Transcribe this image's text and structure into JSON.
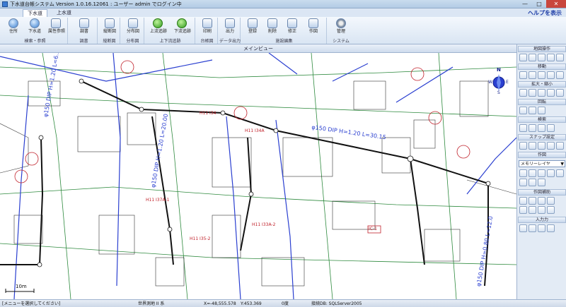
{
  "window": {
    "title": "下水道台帳システム  Version 1.0.16.12061 : ユーザー admin でログイン中",
    "minimize": "—",
    "maximize": "□",
    "close": "✕"
  },
  "tabs": [
    {
      "label": "下水道",
      "active": true
    },
    {
      "label": "上水道",
      "active": false
    }
  ],
  "help_link": "ヘルプを表示",
  "ribbon": {
    "groups": [
      {
        "label": "検索・参照",
        "buttons": [
          "住所",
          "下水道",
          "属性参照"
        ]
      },
      {
        "label": "調書",
        "buttons": [
          "調書"
        ]
      },
      {
        "label": "縦断図",
        "buttons": [
          "縦断図"
        ]
      },
      {
        "label": "分布図",
        "buttons": [
          "分布図"
        ]
      },
      {
        "label": "上下流追跡",
        "buttons": [
          "上流追跡",
          "下流追跡"
        ]
      },
      {
        "label": "台帳図",
        "buttons": [
          "印刷"
        ]
      },
      {
        "label": "データ出力",
        "buttons": [
          "出力"
        ]
      },
      {
        "label": "施設編集",
        "buttons": [
          "登録",
          "削除",
          "修正",
          "作図"
        ]
      },
      {
        "label": "システム",
        "buttons": [
          "管理"
        ]
      }
    ]
  },
  "map_header": "メインビュー",
  "map_labels": {
    "pipe1": "φ150 DIP H=1.20 L=6.17",
    "pipe2": "φ150 DIP H=1.20 L=30.15",
    "pipe3": "φ150 DIP H=1.20 L=20.00",
    "pipe4": "φ150 DIP H=0.80 L=12.0",
    "manhole1": "H11 I34",
    "manhole2": "H11 I34A",
    "manhole3": "H11 I37A-1",
    "manhole4": "H11 I35-2",
    "manhole5": "H11 I33A-2",
    "box": "IC-1",
    "scale": "10m",
    "north": "N",
    "east": "E",
    "south": "S",
    "west": "W"
  },
  "right_panel": {
    "sections": [
      "地図操作",
      "移動",
      "拡大・縮小",
      "回転",
      "検索",
      "スナップ設定",
      "作図",
      "作図補助",
      "入力力"
    ],
    "layer_select": "メモリーレイヤ"
  },
  "status": {
    "message": "[メニューを選択してください]",
    "coord_system": "世界測地 II 系",
    "x": "X=-48,555.578",
    "y": "Y:453.369",
    "angle": "0度",
    "db": "接続DB: SQLServer2005"
  },
  "colors": {
    "accent": "#1a3aa5",
    "pipe_blue": "#2a3fd0",
    "pipe_red": "#c0202a",
    "road": "#2e8a3e"
  }
}
